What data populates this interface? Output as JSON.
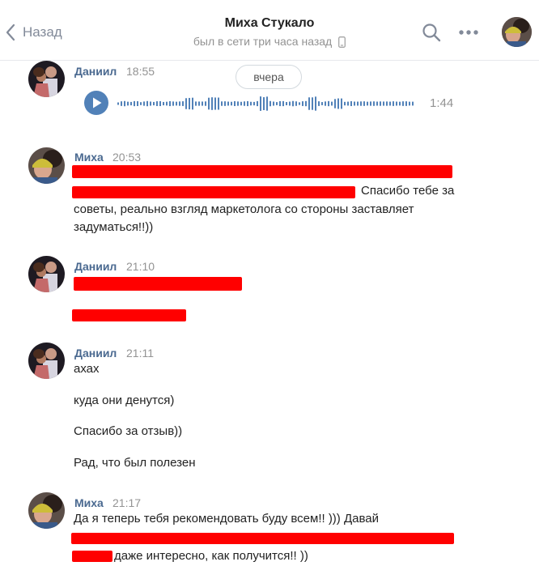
{
  "header": {
    "back_label": "Назад",
    "title": "Миха Стукало",
    "status": "был в сети три часа назад"
  },
  "date_separator": "вчера",
  "messages": [
    {
      "author": "Даниил",
      "time": "18:55",
      "voice": {
        "duration": "1:44"
      }
    },
    {
      "author": "Миха",
      "time": "20:53",
      "lines": [
        "Спасибо тебе за",
        "советы, реально взгляд маркетолога со стороны заставляет",
        "задуматься!!))"
      ]
    },
    {
      "author": "Даниил",
      "time": "21:10"
    },
    {
      "author": "Даниил",
      "time": "21:11",
      "lines": [
        "ахах",
        "куда они денутся)",
        "Спасибо за отзыв))",
        "Рад, что был полезен"
      ]
    },
    {
      "author": "Миха",
      "time": "21:17",
      "lines": [
        "Да я теперь тебя рекомендовать буду всем!! ))) Давай",
        "даже интересно, как получится!! ))"
      ]
    }
  ],
  "colors": {
    "author": "#4a6990",
    "accent": "#5181b8",
    "muted": "#939393",
    "redaction": "#ff0000"
  },
  "icons": [
    "chevron-left-icon",
    "phone-icon",
    "search-icon",
    "more-dots-icon",
    "play-icon",
    "waveform-icon"
  ]
}
